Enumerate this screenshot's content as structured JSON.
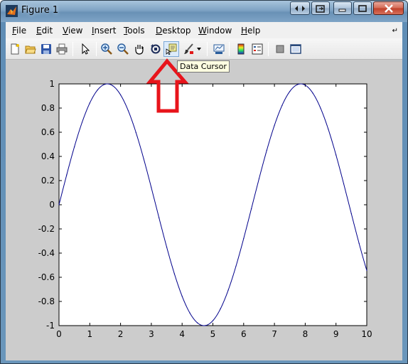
{
  "window": {
    "title": "Figure 1"
  },
  "menubar": {
    "items": [
      {
        "label": "File",
        "ul": "F",
        "rest": "ile"
      },
      {
        "label": "Edit",
        "ul": "E",
        "rest": "dit"
      },
      {
        "label": "View",
        "ul": "V",
        "rest": "iew"
      },
      {
        "label": "Insert",
        "ul": "I",
        "rest": "nsert"
      },
      {
        "label": "Tools",
        "ul": "T",
        "rest": "ools"
      },
      {
        "label": "Desktop",
        "ul": "D",
        "rest": "esktop"
      },
      {
        "label": "Window",
        "ul": "W",
        "rest": "indow"
      },
      {
        "label": "Help",
        "ul": "H",
        "rest": "elp"
      }
    ]
  },
  "toolbar": {
    "buttons": [
      "new-figure-icon",
      "open-file-icon",
      "save-icon",
      "print-icon",
      "edit-plot-arrow-icon",
      "zoom-in-icon",
      "zoom-out-icon",
      "pan-hand-icon",
      "rotate-3d-icon",
      "data-cursor-icon",
      "brush-icon",
      "brush-dropdown-icon",
      "link-plot-icon",
      "colorbar-icon",
      "legend-icon",
      "hide-plot-tools-icon",
      "show-plot-tools-icon"
    ],
    "tooltip": "Data Cursor"
  },
  "annotation": {
    "arrow_color": "#e8141b"
  },
  "colors": {
    "line": "#00008b",
    "axes_bg": "#ffffff",
    "figure_bg": "#cccccc"
  },
  "chart_data": {
    "type": "line",
    "function": "sin(x)",
    "x": [
      0,
      0.25,
      0.5,
      0.75,
      1,
      1.25,
      1.5,
      1.75,
      2,
      2.25,
      2.5,
      2.75,
      3,
      3.25,
      3.5,
      3.75,
      4,
      4.25,
      4.5,
      4.75,
      5,
      5.25,
      5.5,
      5.75,
      6,
      6.25,
      6.5,
      6.75,
      7,
      7.25,
      7.5,
      7.75,
      8,
      8.25,
      8.5,
      8.75,
      9,
      9.25,
      9.5,
      9.75,
      10
    ],
    "series": [
      {
        "values": [
          0,
          0.247,
          0.479,
          0.682,
          0.841,
          0.949,
          0.997,
          0.984,
          0.909,
          0.778,
          0.598,
          0.382,
          0.141,
          -0.108,
          -0.351,
          -0.572,
          -0.757,
          -0.895,
          -0.978,
          -0.999,
          -0.959,
          -0.859,
          -0.706,
          -0.508,
          -0.279,
          -0.033,
          0.215,
          0.45,
          0.657,
          0.823,
          0.938,
          0.995,
          0.989,
          0.923,
          0.798,
          0.624,
          0.412,
          0.174,
          -0.075,
          -0.319,
          -0.544
        ]
      }
    ],
    "xlim": [
      0,
      10
    ],
    "ylim": [
      -1,
      1
    ],
    "xticks": [
      "0",
      "1",
      "2",
      "3",
      "4",
      "5",
      "6",
      "7",
      "8",
      "9",
      "10"
    ],
    "yticks": [
      "1",
      "0.8",
      "0.6",
      "0.4",
      "0.2",
      "0",
      "-0.2",
      "-0.4",
      "-0.6",
      "-0.8",
      "-1"
    ],
    "grid": false,
    "title": "",
    "xlabel": "",
    "ylabel": ""
  }
}
